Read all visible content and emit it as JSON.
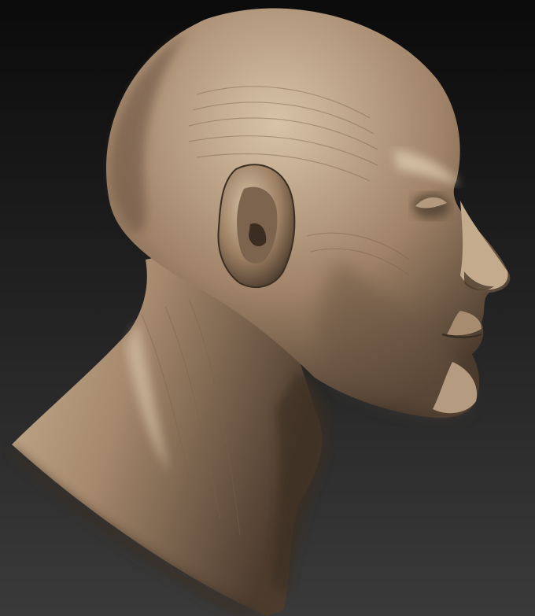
{
  "viewport": {
    "subject": "sculpted-head-bust",
    "colors": {
      "background_top": "#0b0b0b",
      "background_bottom": "#3a3a3a",
      "clay_light": "#d8c3a6",
      "clay_mid": "#a08368",
      "clay_dark": "#4a3a2c",
      "clay_shadow": "#2b221a"
    }
  }
}
